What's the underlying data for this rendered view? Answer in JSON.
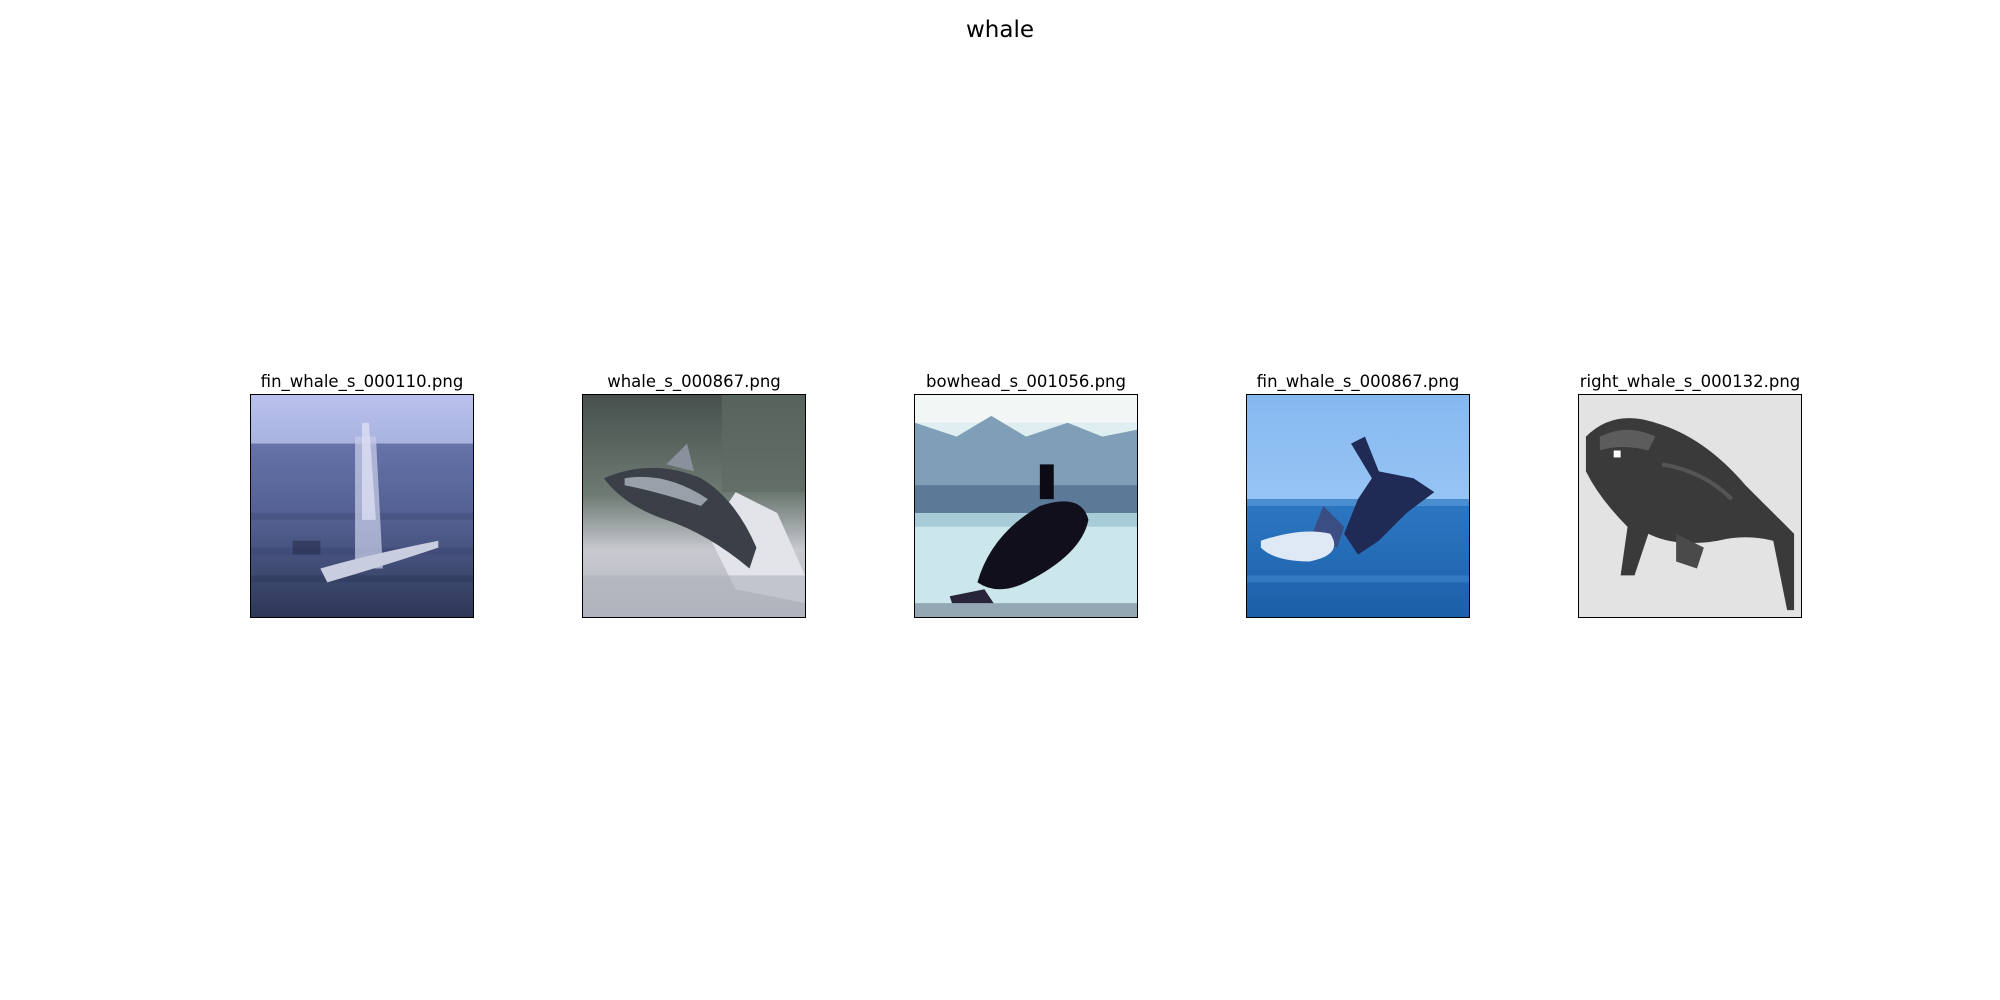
{
  "figure": {
    "title": "whale"
  },
  "panels": [
    {
      "filename": "fin_whale_s_000110.png"
    },
    {
      "filename": "whale_s_000867.png"
    },
    {
      "filename": "bowhead_s_001056.png"
    },
    {
      "filename": "fin_whale_s_000867.png"
    },
    {
      "filename": "right_whale_s_000132.png"
    }
  ]
}
